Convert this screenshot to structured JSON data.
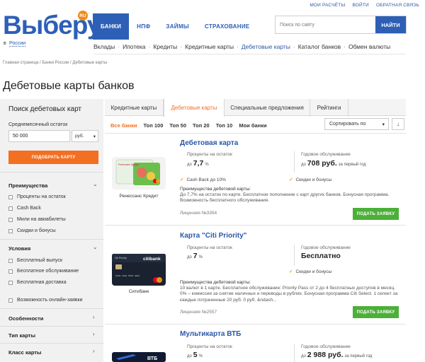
{
  "top_links": [
    "МОИ РАСЧЁТЫ",
    "ВОЙТИ",
    "ОБРАТНАЯ СВЯЗЬ"
  ],
  "logo": {
    "text": "Выберу",
    "badge": "RU"
  },
  "city": {
    "prefix": "в",
    "name": "России"
  },
  "nav": [
    "БАНКИ",
    "НПФ",
    "ЗАЙМЫ",
    "СТРАХОВАНИЕ"
  ],
  "subnav": [
    "Вклады",
    "Ипотека",
    "Кредиты",
    "Кредитные карты",
    "Дебетовые карты",
    "Каталог банков",
    "Обмен валюты"
  ],
  "search": {
    "placeholder": "Поиск по сайту",
    "button": "НАЙТИ"
  },
  "breadcrumb": "Главная страница / Банки России / Дебетовые карты",
  "page_title": "Дебетовые карты банков",
  "sidebar": {
    "title": "Поиск дебетовых карт",
    "monthly_label": "Среднемесячный остаток",
    "amount": "50 000",
    "currency": "руб.",
    "pick_button": "ПОДОБРАТЬ КАРТУ",
    "group_advantages": "Преимущества",
    "advantages": [
      "Проценты на остаток",
      "Cash Back",
      "Мили на авиабилеты",
      "Скидки и бонусы"
    ],
    "group_conditions": "Условия",
    "conditions": [
      "Бесплатный выпуск",
      "Бесплатное обслуживание",
      "Бесплатная доставка",
      "Возможность онлайн-заявки"
    ],
    "group_features": "Особенности",
    "group_card_type": "Тип карты",
    "group_card_class": "Класс карты"
  },
  "tabs": [
    "Кредитные карты",
    "Дебетовые карты",
    "Специальные предложения",
    "Рейтинги"
  ],
  "filters": [
    "Все банки",
    "Топ 100",
    "Топ 50",
    "Топ 20",
    "Топ 10",
    "Мои банки"
  ],
  "sort": {
    "label": "Сортировать по",
    "dir_icon": "↓"
  },
  "cards": [
    {
      "name": "Дебетовая карта",
      "bank": "Ренессанс Кредит",
      "rate_label": "Проценты на остаток",
      "rate_prefix": "до",
      "rate": "7,7",
      "rate_unit": "%",
      "fee_label": "Годовое обслуживание",
      "fee_prefix": "до",
      "fee": "708 руб.",
      "fee_note": "за первый год",
      "features": [
        "Cash Back до 10%",
        "Скидки и бонусы"
      ],
      "adv_title": "Преимущества дебетовой карты:",
      "adv_text": "До 7,7% на остаток по карте. Бесплатное пополнение с карт других банков. Бонусная программа. Возможность бесплатного обслуживания.",
      "license": "Лицензия №3354",
      "apply": "ПОДАТЬ ЗАЯВКУ"
    },
    {
      "name": "Карта \"Citi Priority\"",
      "bank": "Ситибанк",
      "rate_label": "Проценты на остаток",
      "rate_prefix": "до",
      "rate": "7",
      "rate_unit": "%",
      "fee_label": "Годовое обслуживание",
      "fee": "Бесплатно",
      "features": [
        "Скидки и бонусы"
      ],
      "adv_title": "Преимущества дебетовой карты:",
      "adv_text": "10 валют в 1 карте. Бесплатное обслуживание: Priority Pass от 2 до 4 бесплатных доступов в месяц. 0% – комиссия за снятие наличных и переводы в рублях. Бонусная программа Citi Select. 1 селект за каждые потраченные 20 руб. 0 руб. &ndash...",
      "license": "Лицензия №2557",
      "apply": "ПОДАТЬ ЗАЯВКУ"
    },
    {
      "name": "Мультикарта ВТБ",
      "rate_label": "Проценты на остаток",
      "rate_prefix": "до",
      "rate": "5",
      "rate_unit": "%",
      "fee_label": "Годовое обслуживание",
      "fee_prefix": "до",
      "fee": "2 988 руб.",
      "fee_note": "за первый год"
    }
  ],
  "card_art": {
    "renaissance_brand": "Ренессанс Кредит",
    "citi_brand": "citibank",
    "citi_tier": "Citi Priority",
    "vtb_brand": "ВТБ",
    "mastercard_label": "mastercard",
    "mastercard_sub": "world"
  },
  "colors": {
    "brand_blue": "#2d5fb7",
    "accent_orange": "#f36f21",
    "apply_green": "#4caf39"
  }
}
